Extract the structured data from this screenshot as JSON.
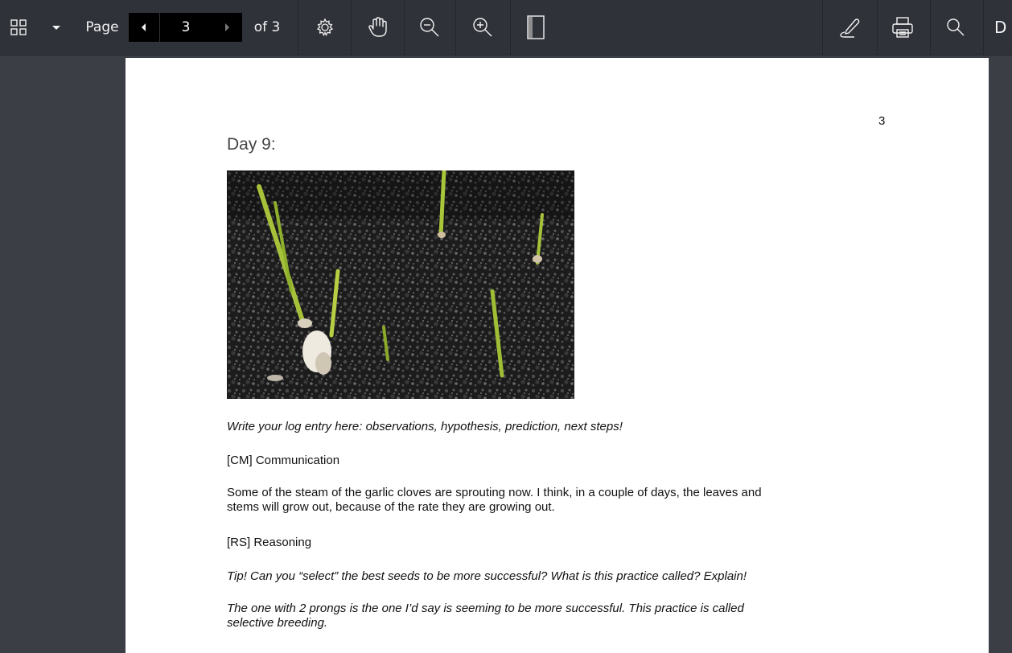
{
  "toolbar": {
    "page_label": "Page",
    "current_page": "3",
    "of_label": "of 3",
    "cut_text": "D",
    "icons": [
      "thumbnails-icon",
      "dropdown-arrow-icon",
      "previous-page-icon",
      "next-page-icon",
      "settings-gear-icon",
      "hand-pan-icon",
      "zoom-out-icon",
      "zoom-in-icon",
      "page-view-icon",
      "draw-pen-icon",
      "print-icon",
      "search-icon"
    ]
  },
  "document": {
    "page_number": "3",
    "title": "Day 9:",
    "image_alt": "garlic-sprouts-in-soil",
    "prompt1": "Write your log entry here: observations, hypothesis, prediction, next steps!",
    "cm_label": "[CM] Communication",
    "entry_line1": "Some of the steam of the garlic cloves are sprouting now. I think, in a couple of days, the leaves and",
    "entry_line2": "stems will grow out, because of the rate they are growing out.",
    "rs_label": "[RS] Reasoning",
    "tip": "Tip! Can you “select” the best seeds to be more successful? What is this practice called? Explain!",
    "answer_line1": "The one with 2 prongs is the one I’d say is seeming to be more successful. This practice is called",
    "answer_line2": "selective breeding."
  },
  "colors": {
    "toolbar_bg": "#30323a",
    "viewer_bg": "#3c3e45",
    "page_bg": "#ffffff",
    "nav_bg": "#000000"
  }
}
